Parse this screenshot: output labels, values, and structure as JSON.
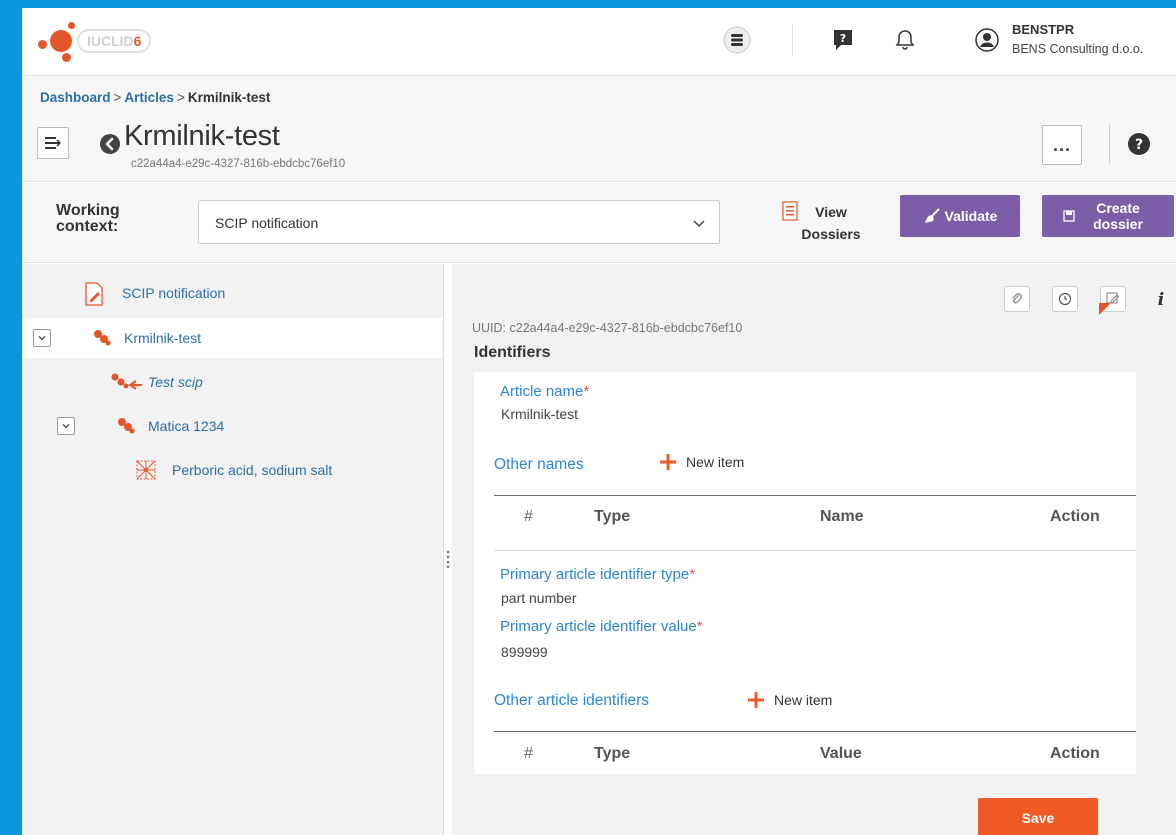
{
  "app": {
    "logo_text": "IUCLID",
    "logo_version": "6"
  },
  "user": {
    "name": "BENSTPR",
    "org": "BENS Consulting d.o.o."
  },
  "header": {
    "breadcrumb": [
      "Dashboard",
      "Articles",
      "Krmilnik-test"
    ],
    "breadcrumb_sep": ">",
    "title": "Krmilnik-test",
    "uuid": "c22a44a4-e29c-4327-816b-ebdcbc76ef10",
    "more_label": "..."
  },
  "context": {
    "label": "Working context:",
    "selected": "SCIP notification",
    "view_dossiers": "View Dossiers",
    "validate": "Validate",
    "create_dossier": "Create dossier"
  },
  "tree": {
    "items": [
      {
        "label": "SCIP notification",
        "icon": "document-edit-icon"
      },
      {
        "label": "Krmilnik-test",
        "icon": "article-icon"
      },
      {
        "label": "Test scip",
        "icon": "article-link-icon"
      },
      {
        "label": "Matica 1234",
        "icon": "article-icon"
      },
      {
        "label": "Perboric acid, sodium salt",
        "icon": "substance-icon"
      }
    ]
  },
  "detail": {
    "uuid_line": "UUID: c22a44a4-e29c-4327-816b-ebdcbc76ef10",
    "section": "Identifiers",
    "article_name_label": "Article name",
    "article_name_value": "Krmilnik-test",
    "other_names_label": "Other names",
    "new_item": "New item",
    "other_names_cols": [
      "#",
      "Type",
      "Name",
      "Action"
    ],
    "primary_type_label": "Primary article identifier type",
    "primary_type_value": "part number",
    "primary_value_label": "Primary article identifier value",
    "primary_value_value": "899999",
    "other_ids_label": "Other article identifiers",
    "other_ids_cols": [
      "#",
      "Type",
      "Value",
      "Action"
    ],
    "required_mark": "*",
    "save": "Save"
  },
  "colors": {
    "accent_blue": "#2a86d4",
    "purple": "#7b5ea7",
    "orange": "#f05a24",
    "frame": "#0a96dc"
  }
}
